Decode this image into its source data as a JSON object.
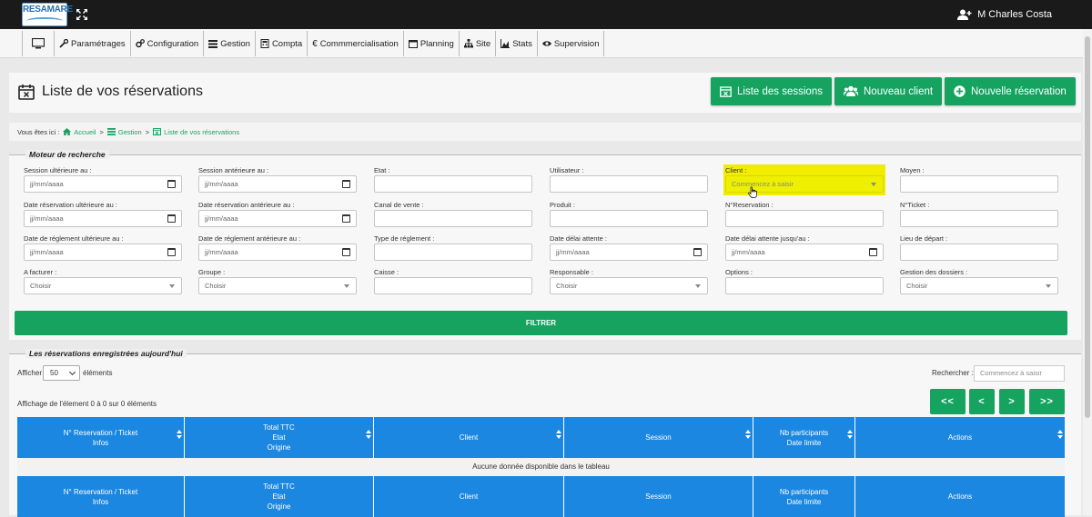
{
  "topbar": {
    "logo_text": "RESAMARE",
    "user_name": "M Charles Costa"
  },
  "nav": {
    "items": [
      "Paramétrages",
      "Configuration",
      "Gestion",
      "Compta",
      "Commmercialisation",
      "Planning",
      "Site",
      "Stats",
      "Supervision"
    ]
  },
  "header": {
    "title": "Liste de vos réservations",
    "btn_sessions": "Liste des sessions",
    "btn_new_client": "Nouveau client",
    "btn_new_reservation": "Nouvelle réservation"
  },
  "breadcrumb": {
    "prefix": "Vous êtes ici :",
    "home": "Accueil",
    "gestion": "Gestion",
    "current": "Liste de vos réservations",
    "sep": ">"
  },
  "search_panel": {
    "legend": "Moteur de recherche",
    "fields": [
      {
        "label": "Session ultérieure au :",
        "value": "jj/mm/aaaa"
      },
      {
        "label": "Session antérieure au :",
        "value": "jj/mm/aaaa"
      },
      {
        "label": "Etat :",
        "value": ""
      },
      {
        "label": "Utilisateur :",
        "value": ""
      },
      {
        "label": "Client :",
        "value": "Commencez à saisir"
      },
      {
        "label": "Moyen :",
        "value": ""
      },
      {
        "label": "Date réservation ultérieure au :",
        "value": "jj/mm/aaaa"
      },
      {
        "label": "Date réservation antérieure au :",
        "value": "jj/mm/aaaa"
      },
      {
        "label": "Canal de vente :",
        "value": ""
      },
      {
        "label": "Produit :",
        "value": ""
      },
      {
        "label": "N°Reservation :",
        "value": ""
      },
      {
        "label": "N°Ticket :",
        "value": ""
      },
      {
        "label": "Date de réglement ultérieure au :",
        "value": "jj/mm/aaaa"
      },
      {
        "label": "Date de réglement antérieure au :",
        "value": "jj/mm/aaaa"
      },
      {
        "label": "Type de réglement :",
        "value": ""
      },
      {
        "label": "Date délai attente :",
        "value": "jj/mm/aaaa"
      },
      {
        "label": "Date délai attente jusqu'au :",
        "value": "jj/mm/aaaa"
      },
      {
        "label": "Lieu de départ :",
        "value": ""
      },
      {
        "label": "A facturer :",
        "value": "Choisir"
      },
      {
        "label": "Groupe :",
        "value": "Choisir"
      },
      {
        "label": "Caisse :",
        "value": ""
      },
      {
        "label": "Responsable :",
        "value": "Choisir"
      },
      {
        "label": "Options :",
        "value": ""
      },
      {
        "label": "Gestion des dossiers :",
        "value": "Choisir"
      }
    ],
    "filter_label": "FILTRER"
  },
  "table_panel": {
    "legend": "Les réservations enregistrées aujourd'hui",
    "show_label": "Afficher",
    "page_size": "50",
    "elements_label": "éléments",
    "search_label": "Rechercher :",
    "search_placeholder": "Commencez à saisir",
    "info": "Affichage de l'élement 0 à 0 sur 0 éléments",
    "pagination": [
      "<<",
      "<",
      ">",
      ">>"
    ],
    "columns": [
      {
        "lines": [
          "N° Reservation / Ticket",
          "Infos"
        ]
      },
      {
        "lines": [
          "Total TTC",
          "Etat",
          "Origine"
        ]
      },
      {
        "lines": [
          "Client"
        ]
      },
      {
        "lines": [
          "Session"
        ]
      },
      {
        "lines": [
          "Nb participants",
          "Date limite"
        ]
      },
      {
        "lines": [
          "Actions"
        ]
      }
    ],
    "empty_text": "Aucune donnée disponible dans le tableau"
  },
  "colors": {
    "accent": "#16a360",
    "table_header": "#1b87e0",
    "highlight": "#f2ec00"
  }
}
